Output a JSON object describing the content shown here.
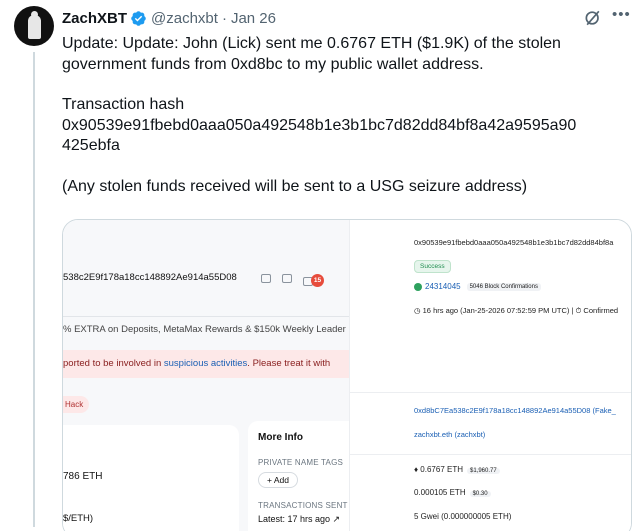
{
  "post": {
    "author_name": "ZachXBT",
    "handle": "@zachxbt",
    "separator": "·",
    "date": "Jan 26",
    "lines": [
      "Update: Update: John (Lick) sent me 0.6767 ETH ($1.9K) of the stolen",
      "government funds from 0xd8bc to my public wallet address."
    ],
    "hash_label": "Transaction hash",
    "hash_line1": "0x90539e91fbebd0aaa050a492548b1e3b1bc7d82dd84bf8a42a9595a90",
    "hash_line2": "425ebfa",
    "footnote": "(Any stolen funds received will be sent to a USG seizure address)"
  },
  "media_left": {
    "address": "538c2E9f178a18cc148892Ae914a55D08",
    "notif_count": "15",
    "promo": "% EXTRA on Deposits, MetaMax Rewards & $150k Weekly Leader",
    "alert_pre": "ported to be involved in ",
    "alert_link": "suspicious activities",
    "alert_post": ". Please treat it with",
    "tag": "Hack",
    "balance": "786 ETH",
    "balance2": "$/ETH)",
    "more_info_title": "More Info",
    "private_tags_label": "PRIVATE NAME TAGS",
    "add_label": "+ Add",
    "tx_sent_label": "TRANSACTIONS SENT",
    "latest_label": "Latest: 17 hrs ago ↗"
  },
  "media_right": {
    "tx_hash": "0x90539e91fbebd0aaa050a492548b1e3b1bc7d82dd84bf8a",
    "status": "Success",
    "block": "24314045",
    "confirmations": "5046 Block Confirmations",
    "time": "16 hrs ago (Jan-25-2026 07:52:59 PM UTC) | ⏱ Confirmed",
    "to_address": "0xd8bC7Ea538c2E9f178a18cc148892Ae914a55D08 (Fake_",
    "ens": "zachxbt.eth (zachxbt)",
    "value": "♦ 0.6767 ETH",
    "value_usd": "$1,960.77",
    "fee": "0.000105 ETH",
    "fee_usd": "$0.30",
    "gas": "5 Gwei (0.000000005 ETH)"
  },
  "colors": {
    "verified": "#1d9bf0",
    "link": "#1a5fb4",
    "alert_bg": "#fde8e8",
    "success": "#2ea15e"
  },
  "icons": [
    "verified-badge-icon",
    "grok-icon",
    "more-icon",
    "copy-icon",
    "qr-icon",
    "notification-icon",
    "check-icon",
    "clock-icon"
  ]
}
